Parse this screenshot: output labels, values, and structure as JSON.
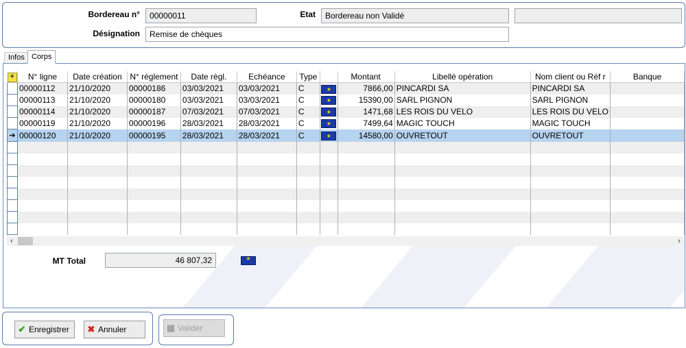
{
  "header": {
    "bordereau_label": "Bordereau n°",
    "bordereau_value": "00000011",
    "etat_label": "Etat",
    "etat_value": "Bordereau non Validé",
    "extra_value": "",
    "designation_label": "Désignation",
    "designation_value": "Remise de chèques"
  },
  "tabs": [
    {
      "label": "Infos",
      "active": false
    },
    {
      "label": "Corps",
      "active": true
    }
  ],
  "grid": {
    "columns": [
      "N° ligne",
      "Date création",
      "N° règlement",
      "Date règl.",
      "Echéance",
      "Type",
      "",
      "Montant",
      "Libellé opération",
      "Nom client ou Réf r",
      "Banque"
    ],
    "rows": [
      [
        "00000112",
        "21/10/2020",
        "00000186",
        "03/03/2021",
        "03/03/2021",
        "C",
        "euro",
        "7866,00",
        "PINCARDI SA",
        "PINCARDI SA",
        ""
      ],
      [
        "00000113",
        "21/10/2020",
        "00000180",
        "03/03/2021",
        "03/03/2021",
        "C",
        "euro",
        "15390,00",
        "SARL PIGNON",
        "SARL PIGNON",
        ""
      ],
      [
        "00000114",
        "21/10/2020",
        "00000187",
        "07/03/2021",
        "07/03/2021",
        "C",
        "euro",
        "1471,68",
        "LES ROIS DU VELO",
        "LES ROIS DU VELO",
        ""
      ],
      [
        "00000119",
        "21/10/2020",
        "00000196",
        "28/03/2021",
        "28/03/2021",
        "C",
        "euro",
        "7499,64",
        "MAGIC TOUCH",
        "MAGIC TOUCH",
        ""
      ],
      [
        "00000120",
        "21/10/2020",
        "00000195",
        "28/03/2021",
        "28/03/2021",
        "C",
        "euro",
        "14580,00",
        "OUVRETOUT",
        "OUVRETOUT",
        ""
      ]
    ],
    "selected_row": 4,
    "empty_rows": 8,
    "row_pointer_glyph": "➔",
    "add_icon_glyph": "+"
  },
  "totals": {
    "label": "MT Total",
    "value": "46 807,32"
  },
  "buttons": {
    "save": "Enregistrer",
    "cancel": "Annuler",
    "validate": "Valider"
  },
  "icons": {
    "add": "add-row-icon",
    "currency": "euro-flag-icon",
    "save": "checkmark-icon",
    "cancel": "cross-icon",
    "validate": "printer-icon"
  },
  "colors": {
    "border": "#5a7aa8",
    "selected_row": "#b6d3ef",
    "alt_row": "#eeeeee",
    "field_bg": "#eeeeee"
  }
}
